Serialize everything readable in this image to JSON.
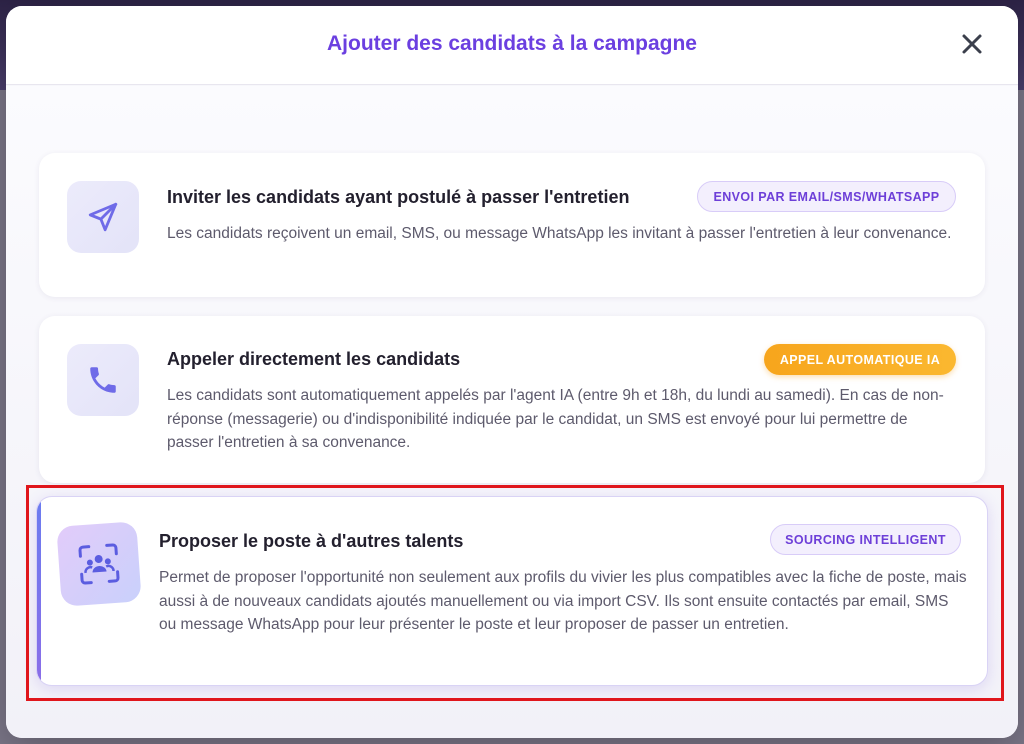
{
  "modal": {
    "title": "Ajouter des candidats à la campagne",
    "close_icon": "close-icon"
  },
  "options": [
    {
      "icon": "paper-plane-icon",
      "title": "Inviter les candidats ayant postulé à passer l'entretien",
      "description": "Les candidats reçoivent un email, SMS, ou message WhatsApp les invitant à passer l'entretien à leur convenance.",
      "badge": "ENVOI PAR EMAIL/SMS/WHATSAPP",
      "badge_style": "purple"
    },
    {
      "icon": "phone-icon",
      "title": "Appeler directement les candidats",
      "description": "Les candidats sont automatiquement appelés par l'agent IA (entre 9h et 18h, du lundi au samedi). En cas de non-réponse (messagerie) ou d'indisponibilité indiquée par le candidat, un SMS est envoyé pour lui permettre de passer l'entretien à sa convenance.",
      "badge": "APPEL AUTOMATIQUE IA",
      "badge_style": "orange"
    },
    {
      "icon": "group-scan-icon",
      "title": "Proposer le poste à d'autres talents",
      "description": "Permet de proposer l'opportunité non seulement aux profils du vivier les plus compatibles avec la fiche de poste, mais aussi à de nouveaux candidats ajoutés manuellement ou via import CSV. Ils sont ensuite contactés par email, SMS ou message WhatsApp pour leur présenter le poste et leur proposer de passer un entretien.",
      "badge": "SOURCING INTELLIGENT",
      "badge_style": "purple"
    }
  ],
  "colors": {
    "accent": "#6b3fe0",
    "highlight": "#e0161c",
    "orange_badge": "#f7a51c"
  }
}
